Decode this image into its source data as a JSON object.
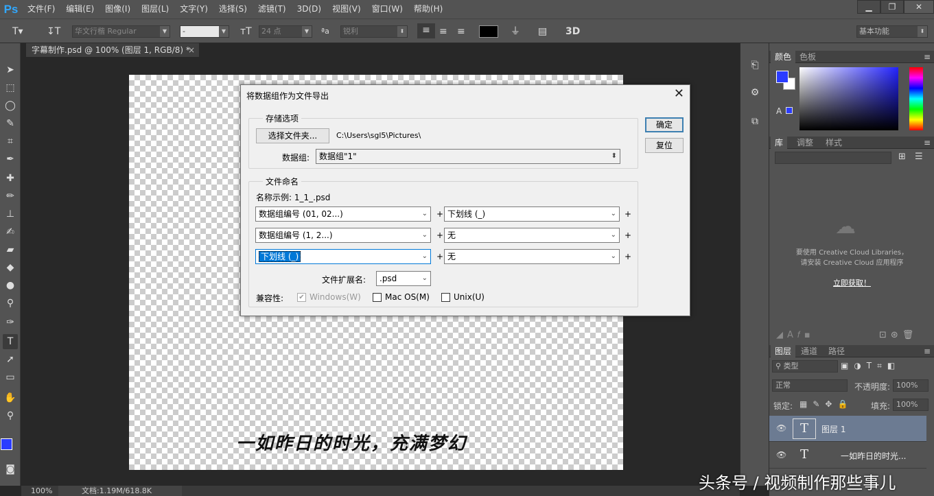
{
  "app": {
    "logo": "Ps",
    "menu": [
      "文件(F)",
      "编辑(E)",
      "图像(I)",
      "图层(L)",
      "文字(Y)",
      "选择(S)",
      "滤镜(T)",
      "3D(D)",
      "视图(V)",
      "窗口(W)",
      "帮助(H)"
    ],
    "window_controls": [
      "▁",
      "❐",
      "✕"
    ]
  },
  "options": {
    "font_family": "华文行楷 Regular",
    "font_style": "-",
    "font_size": "24 点",
    "anti_alias": "锐利",
    "workspace": "基本功能",
    "three_d": "3D"
  },
  "document": {
    "tab_title": "字幕制作.psd @ 100% (图层 1, RGB/8) *",
    "tab_close": "×",
    "canvas_text": "一如昨日的时光，充满梦幻"
  },
  "status": {
    "zoom": "100%",
    "doc_info": "文档:1.19M/618.8K"
  },
  "dialog": {
    "title": "将数据组作为文件导出",
    "close": "✕",
    "storage": {
      "group": "存储选项",
      "choose_folder": "选择文件夹...",
      "path": "C:\\Users\\sgl5\\Pictures\\",
      "dataset_label": "数据组:",
      "dataset_value": "数据组\"1\""
    },
    "naming": {
      "group": "文件命名",
      "example": "名称示例: 1_1_.psd",
      "rows": [
        [
          "数据组编号 (01, 02...)",
          "下划线 (_)"
        ],
        [
          "数据组编号 (1, 2...)",
          "无"
        ],
        [
          "下划线 (_)",
          "无"
        ]
      ],
      "plus": "+",
      "ext_label": "文件扩展名:",
      "ext_value": ".psd",
      "compat_label": "兼容性:",
      "windows": "Windows(W)",
      "mac": "Mac OS(M)",
      "unix": "Unix(U)"
    },
    "ok": "确定",
    "reset": "复位"
  },
  "panels": {
    "color_tabs": [
      "颜色",
      "色板"
    ],
    "lib_tabs": [
      "库",
      "调整",
      "样式"
    ],
    "cc_message_1": "要使用 Creative Cloud Libraries，",
    "cc_message_2": "请安装 Creative Cloud 应用程序",
    "cc_link": "立即获取！",
    "layer_tabs": [
      "图层",
      "通道",
      "路径"
    ],
    "kind": "类型",
    "blend": "正常",
    "opacity_label": "不透明度:",
    "opacity": "100%",
    "lock_label": "锁定:",
    "fill_label": "填充:",
    "fill": "100%",
    "layers": [
      {
        "name": "图层 1",
        "thumb": "T"
      },
      {
        "name": "一如昨日的时光...",
        "thumb": "T"
      }
    ]
  },
  "watermark": "头条号 / 视频制作那些事儿",
  "colors": {
    "foreground": "#2b3cff",
    "background": "#ffffff",
    "accent": "#0078d7"
  }
}
